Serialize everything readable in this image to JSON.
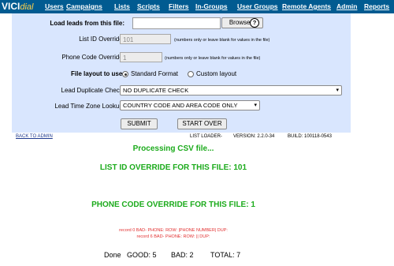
{
  "logo": {
    "text_a": "VICI",
    "text_b": "dial"
  },
  "nav": [
    "Users",
    "Campaigns",
    "Lists",
    "Scripts",
    "Filters",
    "In-Groups",
    "User Groups",
    "Remote Agents",
    "Admin",
    "Reports"
  ],
  "form": {
    "load_file_label": "Load leads from this file:",
    "browse_label": "Browse...",
    "help_glyph": "?",
    "list_id_label": "List ID Override:",
    "list_id_value": "101",
    "list_id_hint": "(numbers only or leave blank for values in the file)",
    "phone_code_label": "Phone Code Override:",
    "phone_code_value": "1",
    "phone_code_hint": "(numbers only or leave blank for values in the file)",
    "layout_label": "File layout to use:",
    "layout_options": [
      "Standard Format",
      "Custom layout"
    ],
    "layout_selected": "Standard Format",
    "dup_label": "Lead Duplicate Check:",
    "dup_value": "NO DUPLICATE CHECK",
    "tz_label": "Lead Time Zone Lookup:",
    "tz_value": "COUNTRY CODE AND AREA CODE ONLY",
    "submit_label": "SUBMIT",
    "start_over_label": "START OVER"
  },
  "footer": {
    "back_link": "BACK TO ADMIN",
    "loader": "LIST LOADER-",
    "version": "VERSION: 2.2.0-34",
    "build": "BUILD: 100118-0543"
  },
  "output": {
    "processing": "Processing CSV file...",
    "list_override": "LIST ID OVERRIDE FOR THIS FILE: 101",
    "phone_override": "PHONE CODE OVERRIDE FOR THIS FILE: 1",
    "errors": [
      "record 0 BAD- PHONE: ROW: |PHONE NUMBER| DUP:",
      "record 6 BAD- PHONE: ROW: || DUP:"
    ],
    "done_label": "Done",
    "good": "GOOD: 5",
    "bad": "BAD: 2",
    "total": "TOTAL: 7"
  },
  "colors": {
    "nav_bg": "#015b91",
    "panel_bg": "#d9e6fe",
    "success": "#1cab1c",
    "error": "#e23030"
  }
}
